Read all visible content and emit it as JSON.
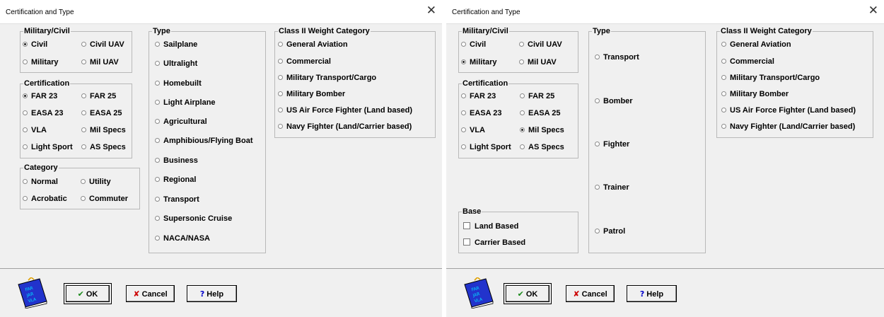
{
  "dialog1": {
    "title": "Certification and Type",
    "military_civil": {
      "legend": "Military/Civil",
      "options": [
        {
          "label": "Civil",
          "selected": true
        },
        {
          "label": "Civil UAV",
          "selected": false
        },
        {
          "label": "Military",
          "selected": false
        },
        {
          "label": "Mil UAV",
          "selected": false
        }
      ]
    },
    "certification": {
      "legend": "Certification",
      "options": [
        {
          "label": "FAR 23",
          "selected": true
        },
        {
          "label": "FAR 25",
          "selected": false
        },
        {
          "label": "EASA 23",
          "selected": false
        },
        {
          "label": "EASA 25",
          "selected": false
        },
        {
          "label": "VLA",
          "selected": false
        },
        {
          "label": "Mil Specs",
          "selected": false
        },
        {
          "label": "Light Sport",
          "selected": false
        },
        {
          "label": "AS Specs",
          "selected": false
        }
      ]
    },
    "category": {
      "legend": "Category",
      "options": [
        {
          "label": "Normal",
          "selected": false
        },
        {
          "label": "Utility",
          "selected": false
        },
        {
          "label": "Acrobatic",
          "selected": false
        },
        {
          "label": "Commuter",
          "selected": false
        }
      ]
    },
    "type": {
      "legend": "Type",
      "options": [
        {
          "label": "Sailplane",
          "selected": false
        },
        {
          "label": "Ultralight",
          "selected": false
        },
        {
          "label": "Homebuilt",
          "selected": false
        },
        {
          "label": "Light Airplane",
          "selected": false
        },
        {
          "label": "Agricultural",
          "selected": false
        },
        {
          "label": "Amphibious/Flying Boat",
          "selected": false
        },
        {
          "label": "Business",
          "selected": false
        },
        {
          "label": "Regional",
          "selected": false
        },
        {
          "label": "Transport",
          "selected": false
        },
        {
          "label": "Supersonic Cruise",
          "selected": false
        },
        {
          "label": "NACA/NASA",
          "selected": false
        }
      ]
    },
    "weight_category": {
      "legend": "Class II Weight Category",
      "options": [
        {
          "label": "General Aviation",
          "selected": false
        },
        {
          "label": "Commercial",
          "selected": false
        },
        {
          "label": "Military Transport/Cargo",
          "selected": false
        },
        {
          "label": "Military Bomber",
          "selected": false
        },
        {
          "label": "US Air Force Fighter (Land based)",
          "selected": false
        },
        {
          "label": "Navy Fighter (Land/Carrier based)",
          "selected": false
        }
      ]
    },
    "buttons": {
      "ok": "OK",
      "cancel": "Cancel",
      "help": "Help"
    },
    "book_text": [
      "FAR",
      "JAR",
      "VLA"
    ]
  },
  "dialog2": {
    "title": "Certification and Type",
    "military_civil": {
      "legend": "Military/Civil",
      "options": [
        {
          "label": "Civil",
          "selected": false
        },
        {
          "label": "Civil UAV",
          "selected": false
        },
        {
          "label": "Military",
          "selected": true
        },
        {
          "label": "Mil UAV",
          "selected": false
        }
      ]
    },
    "certification": {
      "legend": "Certification",
      "options": [
        {
          "label": "FAR 23",
          "selected": false
        },
        {
          "label": "FAR 25",
          "selected": false
        },
        {
          "label": "EASA 23",
          "selected": false
        },
        {
          "label": "EASA 25",
          "selected": false
        },
        {
          "label": "VLA",
          "selected": false
        },
        {
          "label": "Mil Specs",
          "selected": true
        },
        {
          "label": "Light Sport",
          "selected": false
        },
        {
          "label": "AS Specs",
          "selected": false
        }
      ]
    },
    "base": {
      "legend": "Base",
      "options": [
        {
          "label": "Land Based",
          "checked": false
        },
        {
          "label": "Carrier Based",
          "checked": false
        }
      ]
    },
    "type": {
      "legend": "Type",
      "options": [
        {
          "label": "Transport",
          "selected": false
        },
        {
          "label": "Bomber",
          "selected": false
        },
        {
          "label": "Fighter",
          "selected": false
        },
        {
          "label": "Trainer",
          "selected": false
        },
        {
          "label": "Patrol",
          "selected": false
        }
      ]
    },
    "weight_category": {
      "legend": "Class II Weight Category",
      "options": [
        {
          "label": "General Aviation",
          "selected": false
        },
        {
          "label": "Commercial",
          "selected": false
        },
        {
          "label": "Military Transport/Cargo",
          "selected": false
        },
        {
          "label": "Military Bomber",
          "selected": false
        },
        {
          "label": "US Air Force Fighter (Land based)",
          "selected": false
        },
        {
          "label": "Navy Fighter (Land/Carrier based)",
          "selected": false
        }
      ]
    },
    "buttons": {
      "ok": "OK",
      "cancel": "Cancel",
      "help": "Help"
    },
    "book_text": [
      "FAR",
      "JAR",
      "VLA"
    ]
  },
  "colors": {
    "ok_check": "#1a8a1a",
    "cancel_x": "#cc0000",
    "help_q": "#0000cc",
    "book_blue": "#2233cc"
  },
  "icons": {
    "close": "close-icon",
    "ok": "checkmark-icon",
    "cancel": "x-icon",
    "help": "question-icon",
    "book": "book-icon"
  }
}
